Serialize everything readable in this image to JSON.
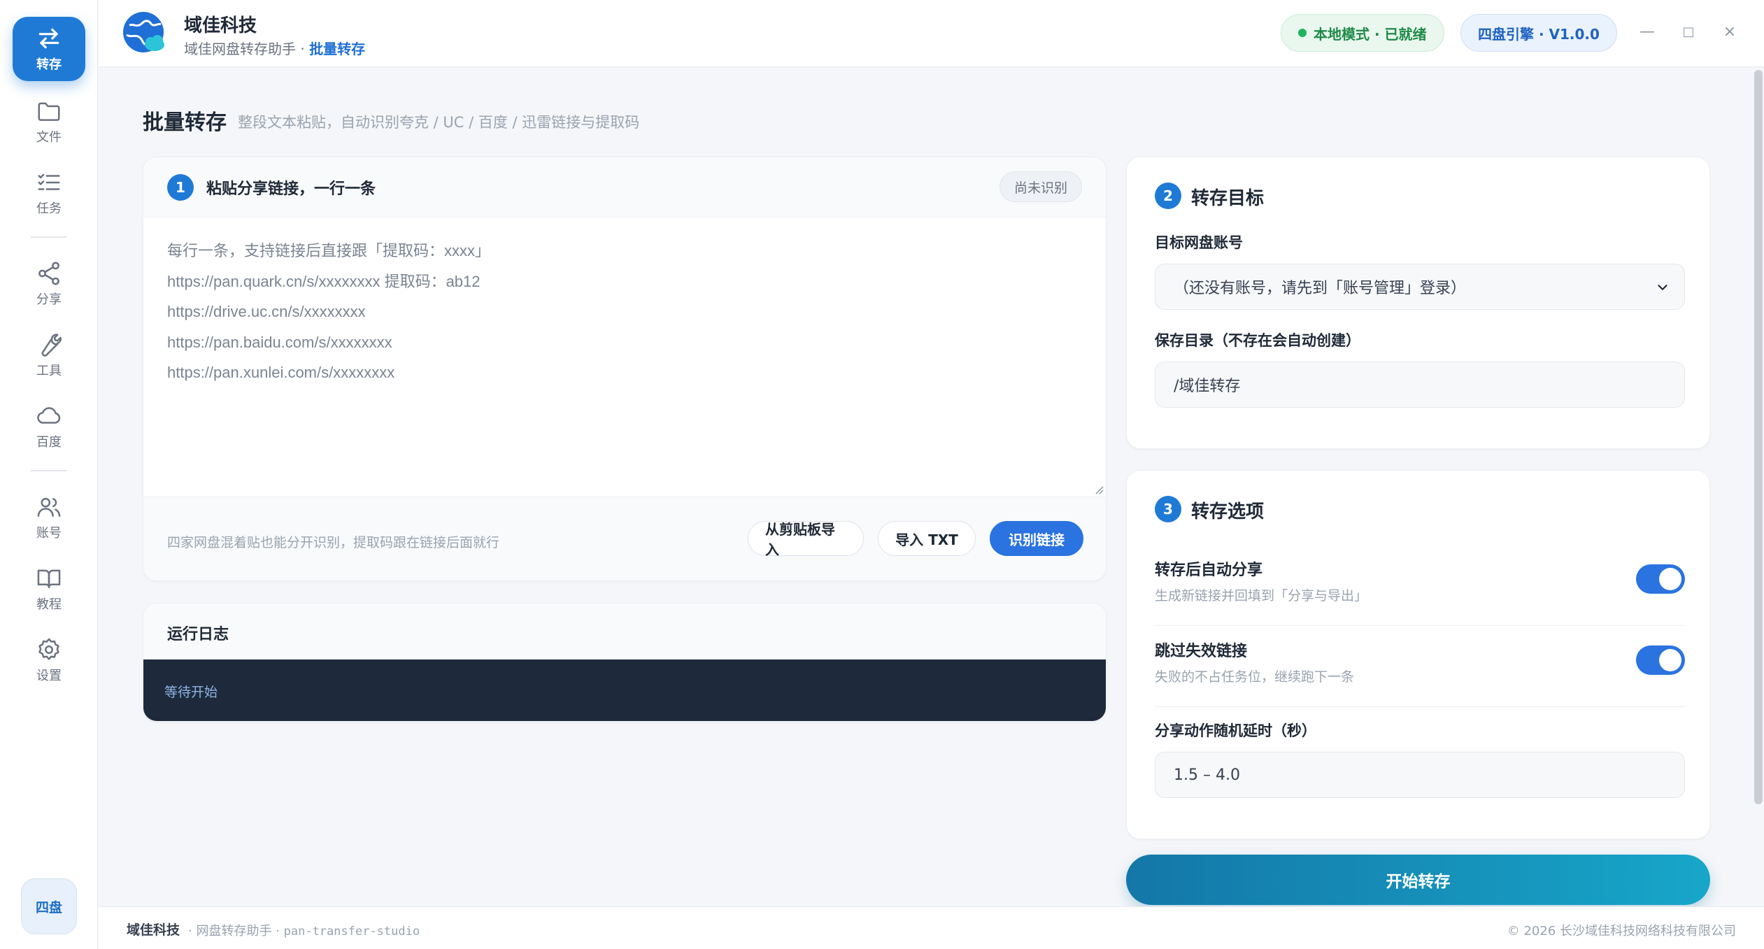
{
  "sidebar": {
    "items": [
      {
        "label": "转存",
        "icon": "transfer-icon",
        "active": true
      },
      {
        "label": "文件",
        "icon": "folder-icon"
      },
      {
        "label": "任务",
        "icon": "task-list-icon"
      },
      {
        "label": "分享",
        "icon": "share-icon"
      },
      {
        "label": "工具",
        "icon": "wrench-icon"
      },
      {
        "label": "百度",
        "icon": "cloud-icon"
      },
      {
        "label": "账号",
        "icon": "users-icon"
      },
      {
        "label": "教程",
        "icon": "book-icon"
      },
      {
        "label": "设置",
        "icon": "gear-icon"
      }
    ],
    "badge": "四盘"
  },
  "header": {
    "brand_name": "域佳科技",
    "brand_sub": "域佳网盘转存助手",
    "brand_sep": "·",
    "brand_current": "批量转存",
    "status_pill": "本地模式 · 已就绪",
    "engine_pill": "四盘引擎 · V1.0.0",
    "window": {
      "minimize": "—",
      "maximize": "□",
      "close": "×"
    }
  },
  "page": {
    "title": "批量转存",
    "subtitle": "整段文本粘贴，自动识别夸克 / UC / 百度 / 迅雷链接与提取码"
  },
  "input_card": {
    "step": "1",
    "title": "粘贴分享链接，一行一条",
    "status_tag": "尚未识别",
    "placeholder_lines": [
      "每行一条，支持链接后直接跟「提取码：xxxx」",
      "https://pan.quark.cn/s/xxxxxxxx  提取码：ab12",
      "https://drive.uc.cn/s/xxxxxxxx",
      "https://pan.baidu.com/s/xxxxxxxx",
      "https://pan.xunlei.com/s/xxxxxxxx"
    ],
    "hint": "四家网盘混着贴也能分开识别，提取码跟在链接后面就行",
    "btn_clipboard": "从剪贴板导入",
    "btn_import_txt": "导入 TXT",
    "btn_recognize": "识别链接"
  },
  "log_card": {
    "title": "运行日志",
    "line": "等待开始"
  },
  "target_card": {
    "step": "2",
    "title": "转存目标",
    "account_label": "目标网盘账号",
    "account_value": "（还没有账号，请先到「账号管理」登录）",
    "dir_label": "保存目录（不存在会自动创建）",
    "dir_value": "/域佳转存"
  },
  "options_card": {
    "step": "3",
    "title": "转存选项",
    "options": [
      {
        "title": "转存后自动分享",
        "desc": "生成新链接并回填到「分享与导出」",
        "enabled": true
      },
      {
        "title": "跳过失效链接",
        "desc": "失败的不占任务位，继续跑下一条",
        "enabled": true
      }
    ],
    "delay_label": "分享动作随机延时（秒）",
    "delay_value": "1.5 – 4.0"
  },
  "start_button": "开始转存",
  "footer": {
    "brand": "域佳科技",
    "sub1": "· 网盘转存助手 ·",
    "code": "pan-transfer-studio",
    "copyright": "© 2026 长沙域佳科技网络科技有限公司"
  },
  "colors": {
    "accent": "#1f7ad6",
    "primary_button": "#2a73e0",
    "status_green": "#1f8a48",
    "log_bg": "#1e2a3b"
  }
}
